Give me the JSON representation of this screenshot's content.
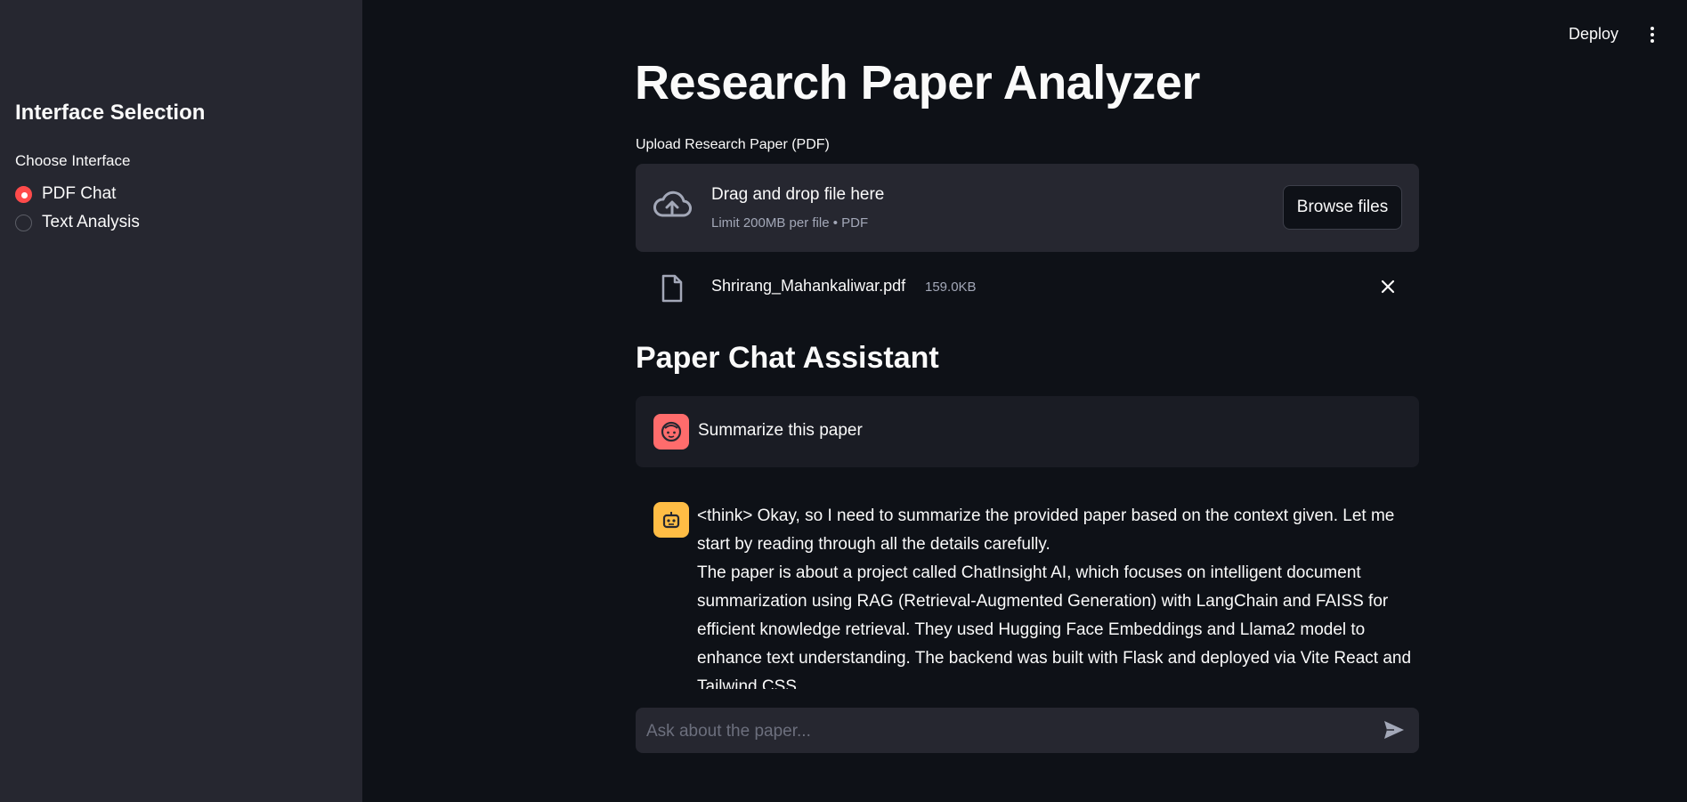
{
  "header": {
    "deploy_label": "Deploy",
    "menu_icon": "kebab-menu-icon"
  },
  "sidebar": {
    "title": "Interface Selection",
    "radio_label": "Choose Interface",
    "options": [
      {
        "label": "PDF Chat",
        "selected": true
      },
      {
        "label": "Text Analysis",
        "selected": false
      }
    ]
  },
  "main": {
    "title": "Research Paper Analyzer",
    "upload": {
      "label": "Upload Research Paper (PDF)",
      "drop_title": "Drag and drop file here",
      "drop_subtitle": "Limit 200MB per file • PDF",
      "browse_label": "Browse files",
      "icon": "cloud-upload-icon"
    },
    "file": {
      "name": "Shrirang_Mahankaliwar.pdf",
      "size": "159.0KB",
      "icon": "file-icon"
    },
    "chat": {
      "title": "Paper Chat Assistant",
      "messages": [
        {
          "role": "user",
          "text": "Summarize this paper"
        },
        {
          "role": "assistant",
          "paragraphs": [
            "<think> Okay, so I need to summarize the provided paper based on the context given. Let me start by reading through all the details carefully.",
            "The paper is about a project called ChatInsight AI, which focuses on intelligent document summarization using RAG (Retrieval-Augmented Generation) with LangChain and FAISS for efficient knowledge retrieval. They used Hugging Face Embeddings and Llama2 model to enhance text understanding. The backend was built with Flask and deployed via Vite React and Tailwind CSS."
          ]
        }
      ],
      "input_placeholder": "Ask about the paper..."
    }
  },
  "colors": {
    "background": "#0e1117",
    "sidebar": "#262730",
    "accent": "#ff4b4b",
    "user_avatar": "#ff6c6c",
    "bot_avatar": "#ffbd45"
  }
}
